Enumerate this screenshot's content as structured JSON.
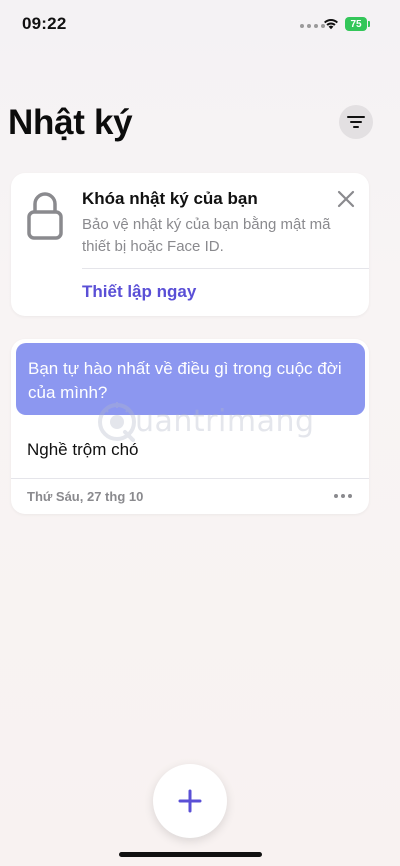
{
  "status_bar": {
    "time": "09:22",
    "battery": "75",
    "battery_color": "#33c659"
  },
  "header": {
    "title": "Nhật ký",
    "filter_icon": "filter-lines-icon"
  },
  "lock_card": {
    "icon": "lock-icon",
    "title": "Khóa nhật ký của bạn",
    "description": "Bảo vệ nhật ký của bạn bằng mật mã thiết bị hoặc Face ID.",
    "action_label": "Thiết lập ngay",
    "close_icon": "close-icon",
    "accent_color": "#5a4fd6"
  },
  "entry_card": {
    "prompt": "Bạn tự hào nhất về điều gì trong cuộc đời của mình?",
    "prompt_color": "#8c97f0",
    "body": "Nghề trộm chó",
    "date": "Thứ Sáu, 27 thg 10",
    "more_icon": "more-dots-icon"
  },
  "watermark": {
    "text": "uantrimang"
  },
  "fab": {
    "icon": "plus-icon",
    "color": "#5a4fd6"
  }
}
